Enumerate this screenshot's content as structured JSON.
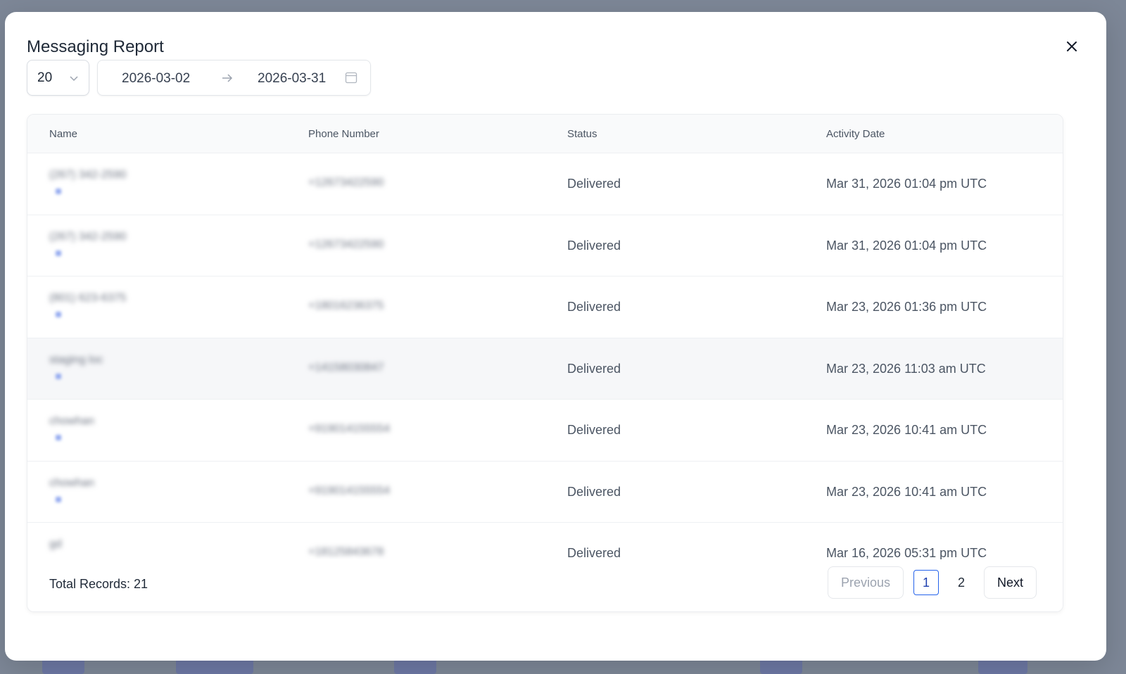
{
  "modal": {
    "title": "Messaging Report"
  },
  "filters": {
    "page_size": "20",
    "date_start": "2026-03-02",
    "date_end": "2026-03-31"
  },
  "table": {
    "columns": [
      "Name",
      "Phone Number",
      "Status",
      "Activity Date"
    ],
    "rows": [
      {
        "name": "(267) 342-2590",
        "phone": "+12673422590",
        "status": "Delivered",
        "date": "Mar 31, 2026 01:04 pm UTC"
      },
      {
        "name": "(267) 342-2590",
        "phone": "+12673422590",
        "status": "Delivered",
        "date": "Mar 31, 2026 01:04 pm UTC"
      },
      {
        "name": "(801) 623-6375",
        "phone": "+18016236375",
        "status": "Delivered",
        "date": "Mar 23, 2026 01:36 pm UTC"
      },
      {
        "name": "staging loc",
        "phone": "+14158030847",
        "status": "Delivered",
        "date": "Mar 23, 2026 11:03 am UTC"
      },
      {
        "name": "chowhan",
        "phone": "+919014155554",
        "status": "Delivered",
        "date": "Mar 23, 2026 10:41 am UTC"
      },
      {
        "name": "chowhan",
        "phone": "+919014155554",
        "status": "Delivered",
        "date": "Mar 23, 2026 10:41 am UTC"
      },
      {
        "name": "gd",
        "phone": "+18125843678",
        "status": "Delivered",
        "date": "Mar 16, 2026 05:31 pm UTC"
      }
    ]
  },
  "footer": {
    "total_records": "Total Records: 21",
    "previous_label": "Previous",
    "pages": [
      "1",
      "2"
    ],
    "current_page": "1",
    "next_label": "Next"
  },
  "colors": {
    "accent": "#2563eb",
    "backdrop": "#7d8797"
  },
  "icons": {
    "close": "close-icon",
    "chevron": "chevron-down-icon",
    "arrow": "arrow-right-icon",
    "calendar": "calendar-icon"
  }
}
